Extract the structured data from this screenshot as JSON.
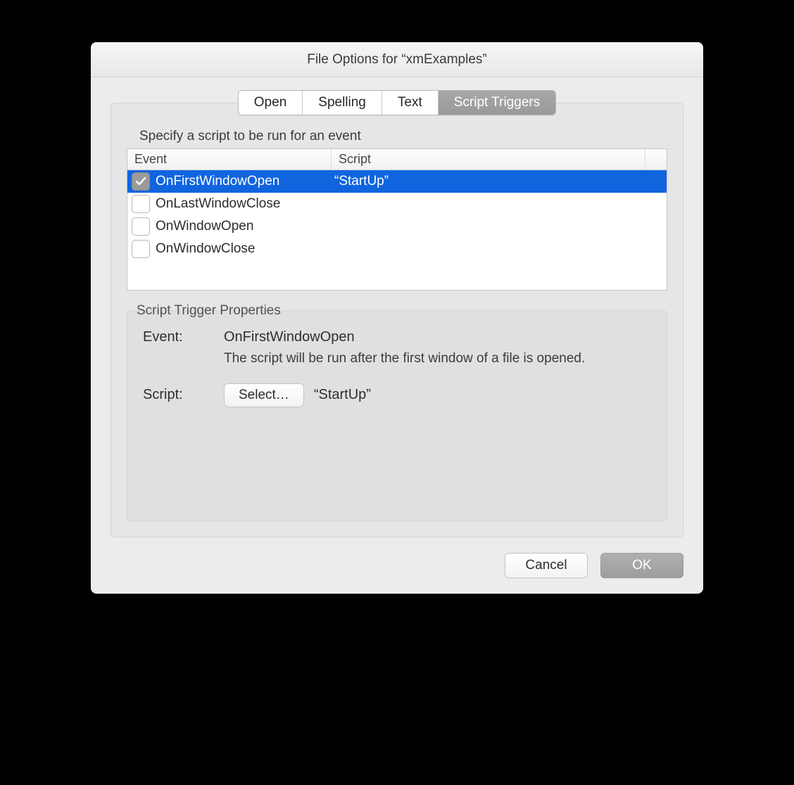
{
  "window": {
    "title": "File Options for “xmExamples”"
  },
  "tabs": {
    "items": [
      "Open",
      "Spelling",
      "Text",
      "Script Triggers"
    ],
    "active_index": 3
  },
  "instruction": "Specify a script to be run for an event",
  "table": {
    "headers": {
      "event": "Event",
      "script": "Script"
    },
    "rows": [
      {
        "checked": true,
        "selected": true,
        "event": "OnFirstWindowOpen",
        "script": "“StartUp”"
      },
      {
        "checked": false,
        "selected": false,
        "event": "OnLastWindowClose",
        "script": ""
      },
      {
        "checked": false,
        "selected": false,
        "event": "OnWindowOpen",
        "script": ""
      },
      {
        "checked": false,
        "selected": false,
        "event": "OnWindowClose",
        "script": ""
      }
    ]
  },
  "properties": {
    "section_label": "Script Trigger Properties",
    "event_label": "Event:",
    "event_value": "OnFirstWindowOpen",
    "event_desc": "The script will be run after the first window of a file is opened.",
    "script_label": "Script:",
    "select_button": "Select…",
    "script_value": "“StartUp”"
  },
  "footer": {
    "cancel": "Cancel",
    "ok": "OK"
  }
}
